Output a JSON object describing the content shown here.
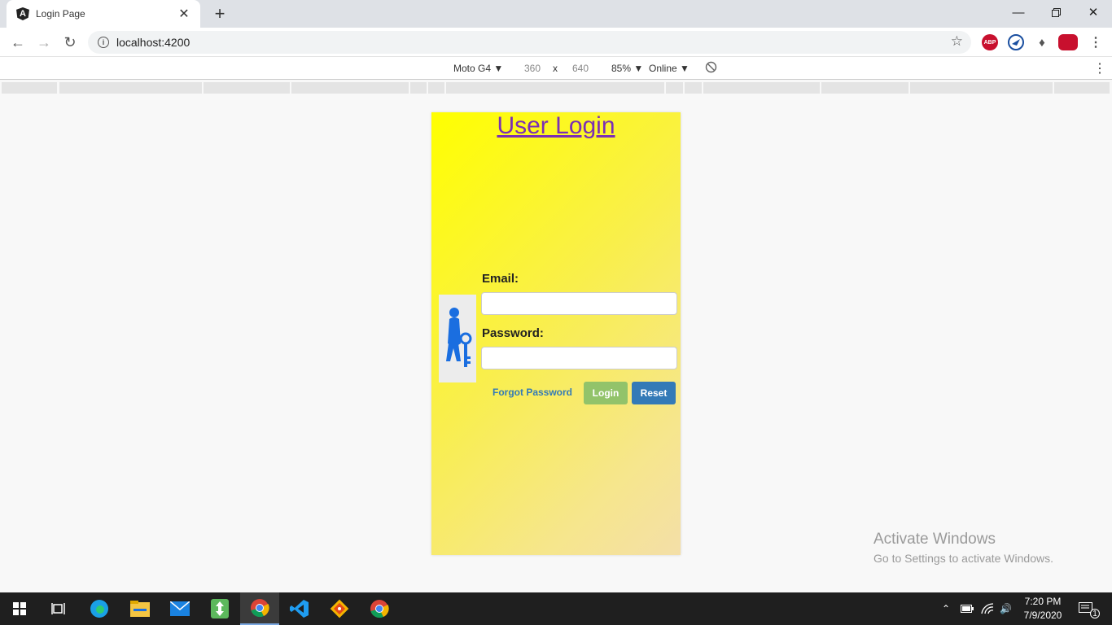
{
  "browser": {
    "tab_title": "Login Page",
    "tab_favicon": "angular-logo",
    "url": "localhost:4200",
    "window_controls": [
      "minimize",
      "restore",
      "close"
    ]
  },
  "device_toolbar": {
    "device": "Moto G4",
    "width": "360",
    "separator": "x",
    "height": "640",
    "zoom": "85%",
    "network": "Online"
  },
  "page": {
    "title": "User Login",
    "email_label": "Email:",
    "email_value": "",
    "password_label": "Password:",
    "password_value": "",
    "forgot_label": "Forgot Password",
    "login_label": "Login",
    "reset_label": "Reset",
    "avatar_icon": "user-key-icon",
    "colors": {
      "title": "#7b2fb5",
      "login": "#92c36a",
      "reset": "#337ab7",
      "link": "#337ab7",
      "background_start": "#ffff00",
      "background_end": "#f4dfa8"
    }
  },
  "watermark": {
    "line1": "Activate Windows",
    "line2": "Go to Settings to activate Windows."
  },
  "taskbar": {
    "apps": [
      "windows-start",
      "task-view",
      "edge",
      "file-explorer",
      "mail",
      "app-green",
      "chrome",
      "vscode",
      "git",
      "chrome"
    ],
    "time": "7:20 PM",
    "date": "7/9/2020",
    "notification_count": "1"
  }
}
